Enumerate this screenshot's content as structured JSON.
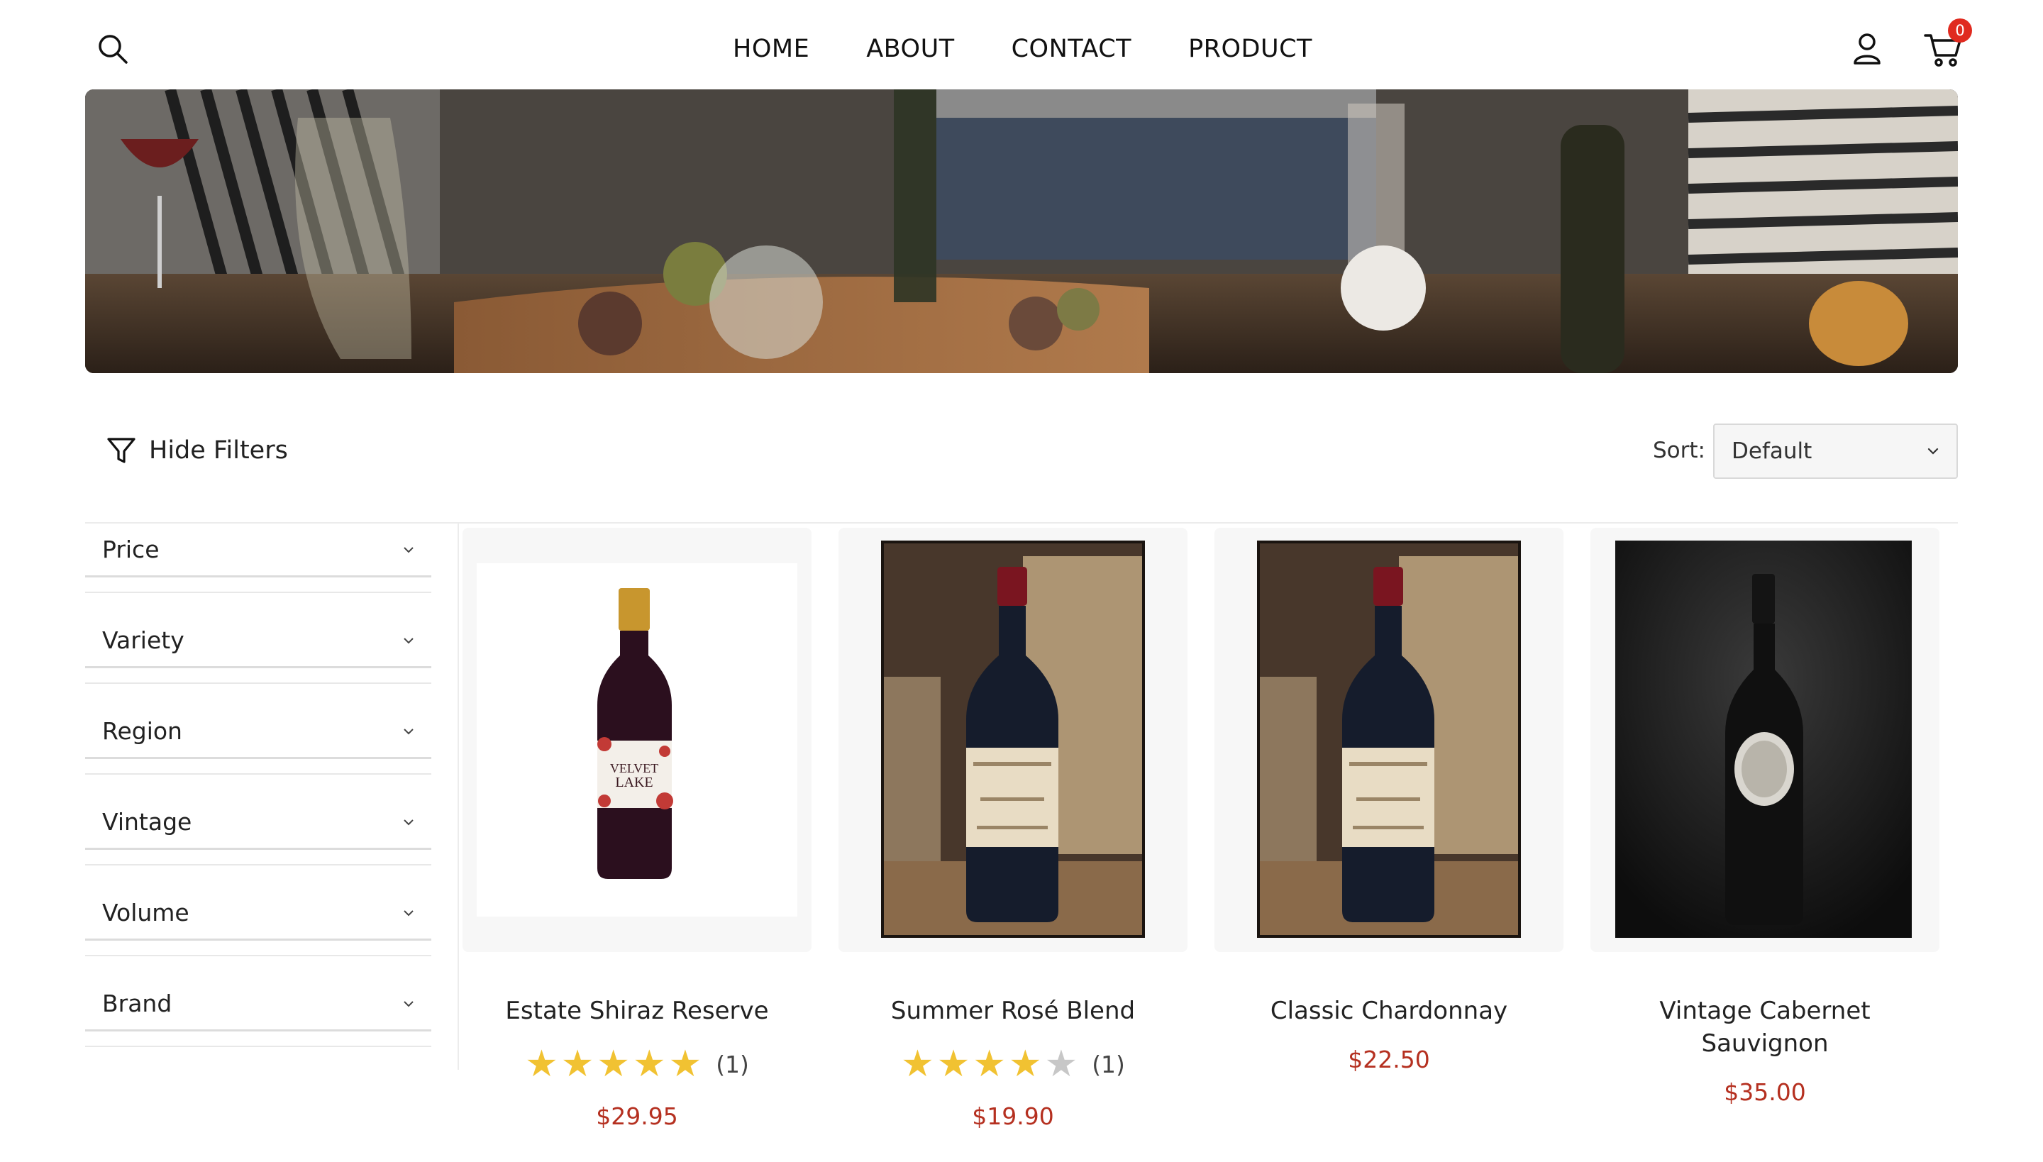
{
  "header": {
    "nav": [
      "HOME",
      "ABOUT",
      "CONTACT",
      "PRODUCT"
    ],
    "cart_count": "0"
  },
  "toolbar": {
    "filter_toggle_label": "Hide Filters",
    "sort_label": "Sort:",
    "sort_value": "Default"
  },
  "filters": [
    "Price",
    "Variety",
    "Region",
    "Vintage",
    "Volume",
    "Brand"
  ],
  "products": [
    {
      "name": "Estate Shiraz Reserve",
      "rating": 5,
      "review_count": "(1)",
      "price": "$29.95"
    },
    {
      "name": "Summer Rosé Blend",
      "rating": 4,
      "review_count": "(1)",
      "price": "$19.90"
    },
    {
      "name": "Classic Chardonnay",
      "price": "$22.50"
    },
    {
      "name": "Vintage Cabernet Sauvignon",
      "price": "$35.00"
    }
  ],
  "colors": {
    "price": "#b53020",
    "badge": "#e02a1f",
    "star": "#f1c232",
    "star_empty": "#c7c7c7"
  },
  "icons": [
    "search-icon",
    "user-icon",
    "cart-icon",
    "filter-icon",
    "chevron-down-icon",
    "star-icon"
  ]
}
